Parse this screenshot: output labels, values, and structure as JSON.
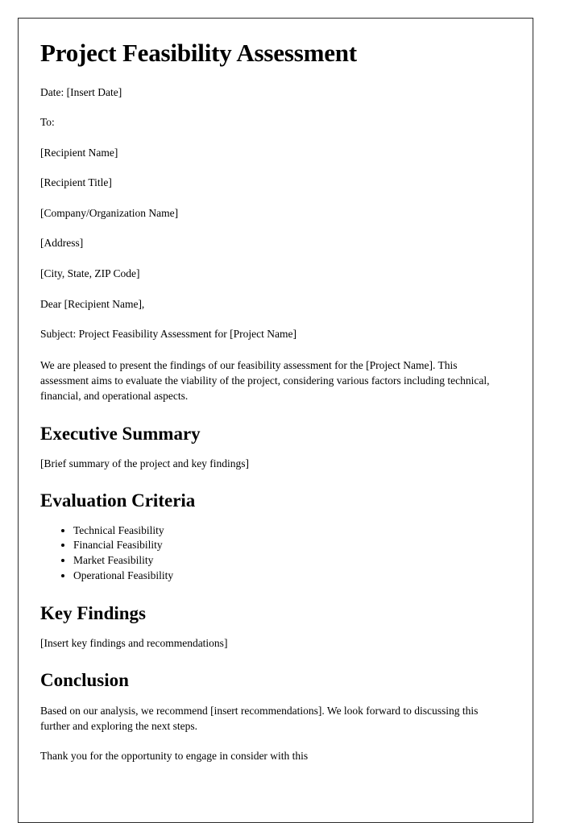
{
  "document": {
    "title": "Project Feasibility Assessment",
    "date_line": "Date: [Insert Date]",
    "to_label": "To:",
    "recipient": {
      "name": "[Recipient Name]",
      "title": "[Recipient Title]",
      "company": "[Company/Organization Name]",
      "address": "[Address]",
      "city_state_zip": "[City, State, ZIP Code]"
    },
    "salutation": "Dear [Recipient Name],",
    "subject": "Subject: Project Feasibility Assessment for [Project Name]",
    "intro_paragraph": "We are pleased to present the findings of our feasibility assessment for the [Project Name]. This assessment aims to evaluate the viability of the project, considering various factors including technical, financial, and operational aspects.",
    "sections": {
      "executive_summary": {
        "heading": "Executive Summary",
        "body": "[Brief summary of the project and key findings]"
      },
      "evaluation_criteria": {
        "heading": "Evaluation Criteria",
        "items": [
          "Technical Feasibility",
          "Financial Feasibility",
          "Market Feasibility",
          "Operational Feasibility"
        ]
      },
      "key_findings": {
        "heading": "Key Findings",
        "body": "[Insert key findings and recommendations]"
      },
      "conclusion": {
        "heading": "Conclusion",
        "body": "Based on our analysis, we recommend [insert recommendations]. We look forward to discussing this further and exploring the next steps.",
        "closing_line": "Thank you for the opportunity to engage in consider with this"
      }
    }
  }
}
